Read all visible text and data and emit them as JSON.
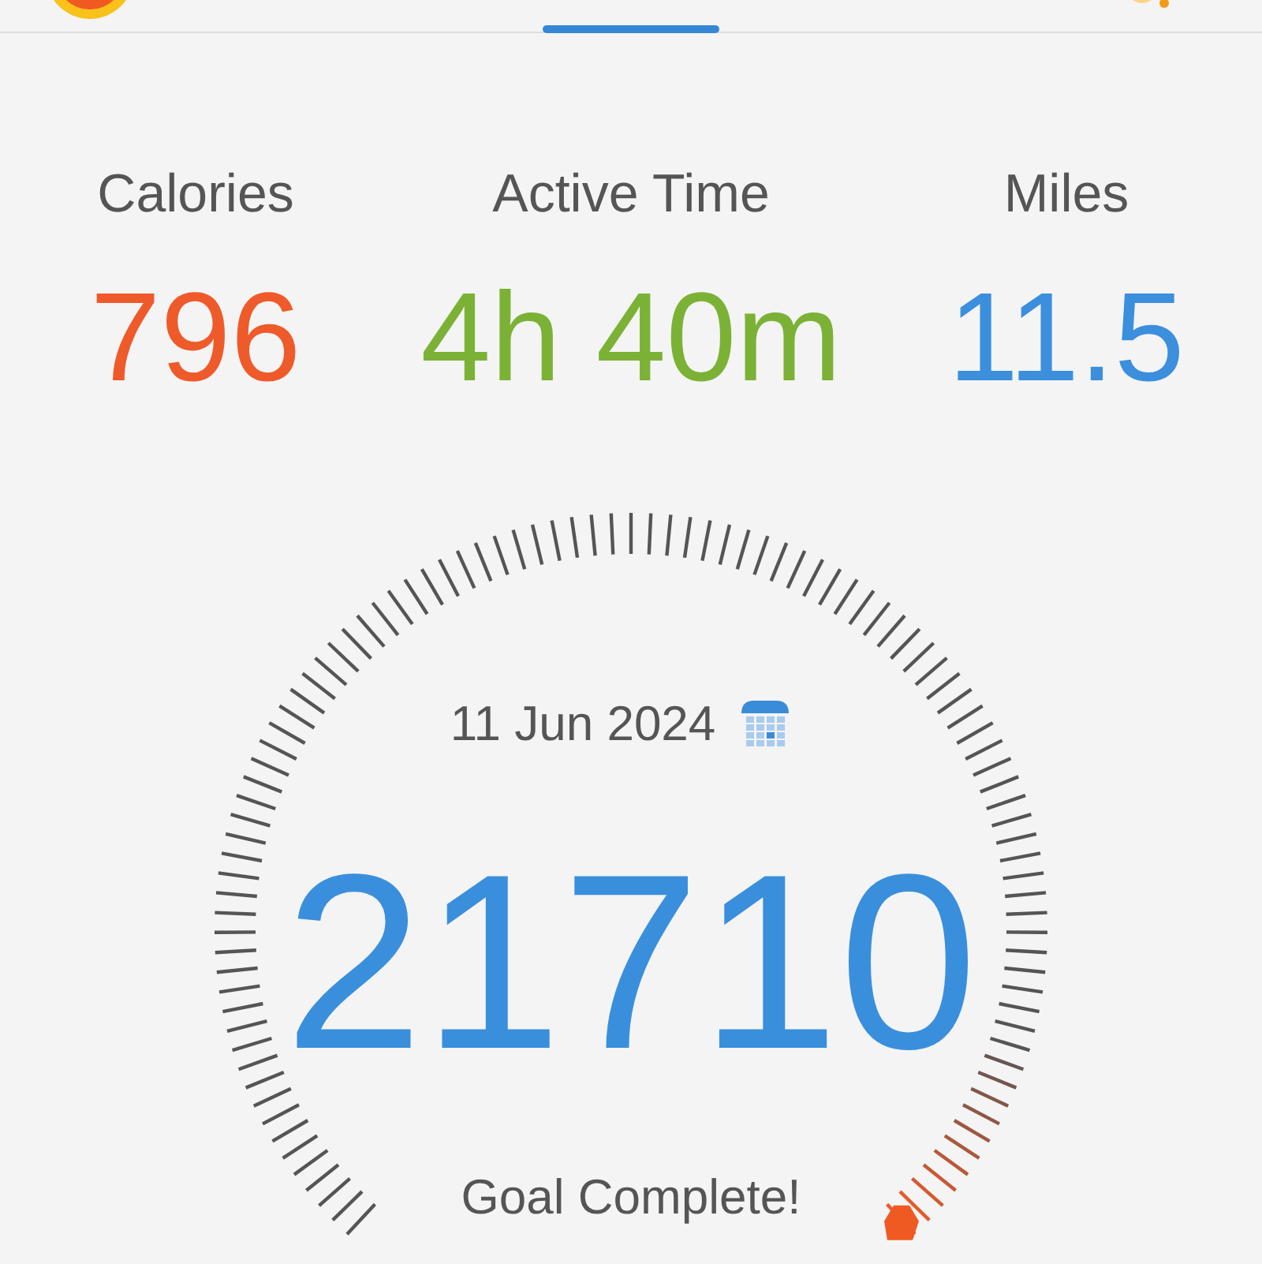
{
  "stats": [
    {
      "label": "Calories",
      "value": "796",
      "color": "#ef5a2a"
    },
    {
      "label": "Active Time",
      "value": "4h 40m",
      "color": "#7bb236"
    },
    {
      "label": "Miles",
      "value": "11.5",
      "color": "#3b8fdd"
    }
  ],
  "dial": {
    "date": "11 Jun 2024",
    "steps": "21710",
    "status": "Goal Complete!"
  }
}
